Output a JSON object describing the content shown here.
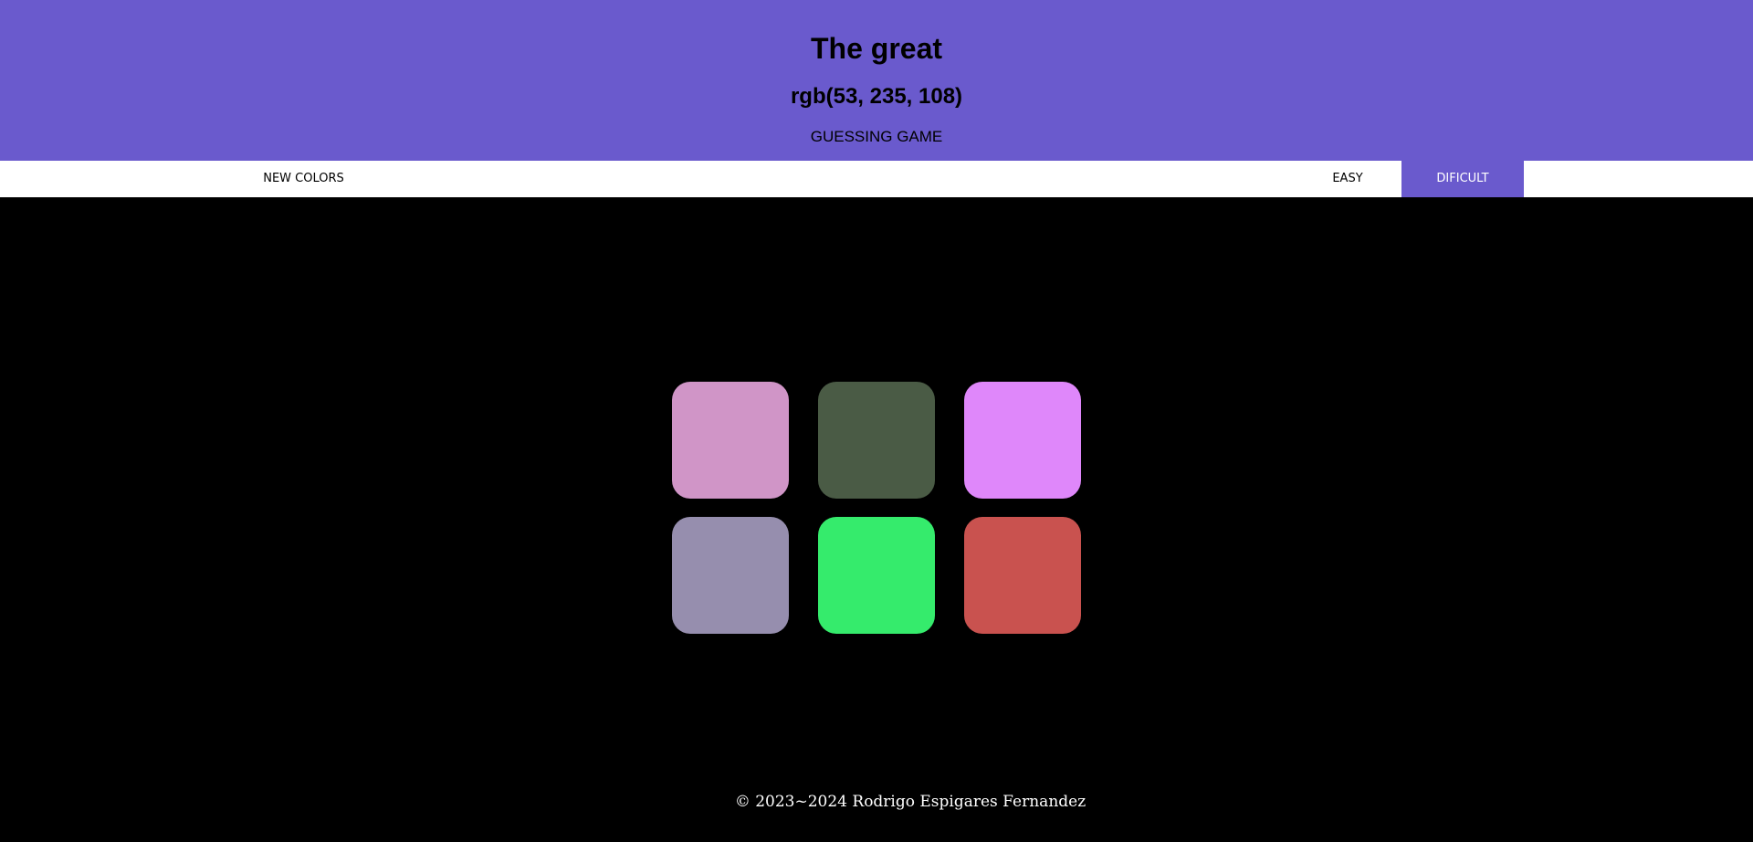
{
  "header": {
    "title": "The great",
    "rgb_target": "rgb(53, 235, 108)",
    "subtitle": "GUESSING GAME",
    "background": "#6a5acd"
  },
  "toolbar": {
    "new_colors_label": "NEW COLORS",
    "easy_label": "EASY",
    "difficult_label": "DIFICULT",
    "selected_mode": "DIFICULT"
  },
  "board": {
    "squares": [
      {
        "color": "#d095c7"
      },
      {
        "color": "#4a5b45"
      },
      {
        "color": "#df87fa"
      },
      {
        "color": "#968eae"
      },
      {
        "color": "#35eb6c"
      },
      {
        "color": "#c9524f"
      }
    ]
  },
  "footer": {
    "copyright": "© 2023~2024 Rodrigo Espigares Fernandez"
  }
}
